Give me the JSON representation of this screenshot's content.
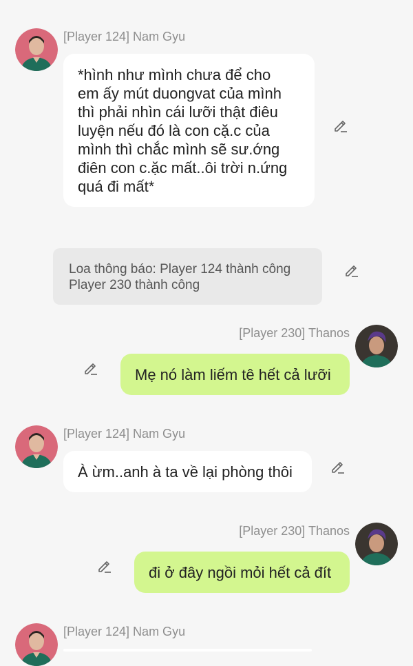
{
  "messages": [
    {
      "sender": "[Player 124] Nam Gyu",
      "lines": [
        "*hình như mình chưa để cho",
        "em ấy mút duongvat của mình",
        "thì phải nhìn cái lưỡi thật điêu",
        "luyện nếu đó là con cặ.c của",
        "mình thì chắc mình sẽ sư.ớng",
        "điên con c.ặc mất..ôi trời n.ứng",
        "quá đi mất*"
      ]
    },
    {
      "lines": [
        "Loa thông báo: Player 124 thành công",
        "Player 230 thành công"
      ]
    },
    {
      "sender": "[Player 230] Thanos",
      "lines": [
        "Mẹ nó làm liếm tê hết cả lưỡi"
      ]
    },
    {
      "sender": "[Player 124] Nam Gyu",
      "lines": [
        "À ừm..anh à ta về lại phòng thôi"
      ]
    },
    {
      "sender": "[Player 230] Thanos",
      "lines": [
        "đi ở đây ngồi mỏi hết cả đít"
      ]
    },
    {
      "sender": "[Player 124] Nam Gyu",
      "lines": []
    }
  ],
  "colors": {
    "background": "#f6f6f6",
    "bubble_incoming": "#ffffff",
    "bubble_outgoing": "#d3f68f",
    "bubble_system": "#e9e9e9",
    "sender_text": "#8e8e8e"
  },
  "icons": {
    "edit": "pencil-edit-icon",
    "avatar_nam_gyu": "avatar-nam-gyu",
    "avatar_thanos": "avatar-thanos"
  }
}
